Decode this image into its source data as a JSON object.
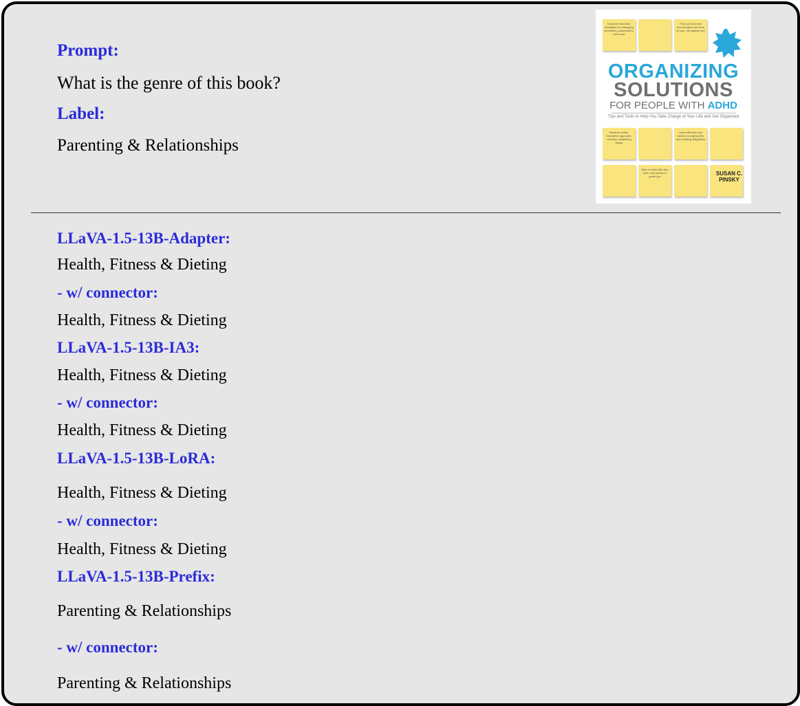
{
  "prompt": {
    "heading": "Prompt:",
    "text": "What is the genre of this book?"
  },
  "label": {
    "heading": "Label:",
    "text": "Parenting & Relationships"
  },
  "book_cover": {
    "title_line1": "ORGANIZING",
    "title_line2": "SOLUTIONS",
    "title_line3_prefix": "FOR PEOPLE WITH ",
    "title_line3_accent": "ADHD",
    "subtitle": "Tips and Tools to Help You Take Charge of Your Life and Get Organized",
    "author_first": "SUSAN C.",
    "author_last": "PINSKY",
    "accent_color": "#2aa7d9",
    "note_color": "#f9e47e"
  },
  "results": [
    {
      "model": "LLaVA-1.5-13B-Adapter:",
      "answer": "Health, Fitness & Dieting"
    },
    {
      "model": "- w/ connector:",
      "answer": "Health, Fitness & Dieting"
    },
    {
      "model": "LLaVA-1.5-13B-IA3:",
      "answer": "Health, Fitness & Dieting"
    },
    {
      "model": "- w/ connector:",
      "answer": "Health, Fitness & Dieting"
    },
    {
      "model": "LLaVA-1.5-13B-LoRA:",
      "answer": "Health, Fitness & Dieting"
    },
    {
      "model": "- w/ connector:",
      "answer": "Health, Fitness & Dieting"
    },
    {
      "model": "LLaVA-1.5-13B-Prefix:",
      "answer": "Parenting & Relationships"
    },
    {
      "model": "- w/ connector:",
      "answer": "Parenting & Relationships"
    }
  ],
  "colors": {
    "heading": "#2b2bd9",
    "background": "#e6e6e6"
  }
}
